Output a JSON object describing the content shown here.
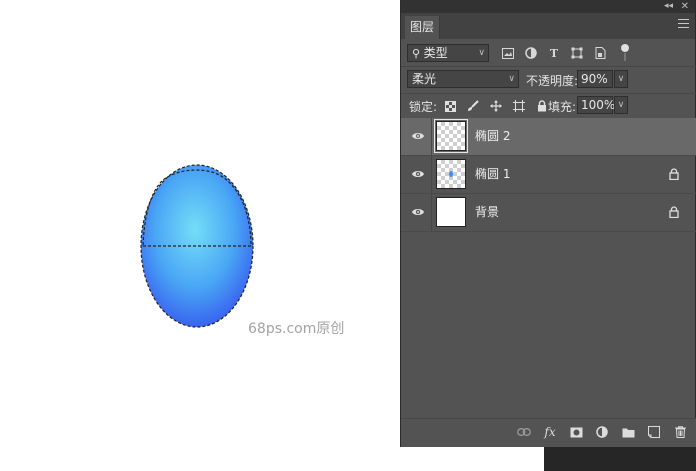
{
  "canvas": {
    "watermark": "68ps.com原创"
  },
  "panel": {
    "tab_label": "图层",
    "filter_type": "类型",
    "blend_mode": "柔光",
    "opacity_label": "不透明度:",
    "opacity_value": "90%",
    "lock_label": "锁定:",
    "fill_label": "填充:",
    "fill_value": "100%",
    "layers": [
      {
        "name": "椭圆 2",
        "selected": true,
        "locked": false
      },
      {
        "name": "椭圆 1",
        "selected": false,
        "locked": true
      },
      {
        "name": "背景",
        "selected": false,
        "locked": true
      }
    ]
  },
  "colors": {
    "panel_bg": "#535353",
    "selected_row": "#696969",
    "ellipse_light": "#6fd9f6",
    "ellipse_dark": "#3a55f0"
  }
}
